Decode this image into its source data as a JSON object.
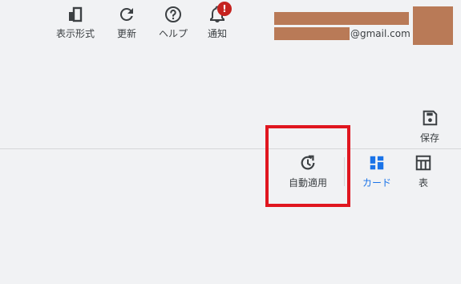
{
  "toolbar": {
    "display_format": "表示形式",
    "refresh": "更新",
    "help": "ヘルプ",
    "notifications": "通知",
    "notification_badge": "!"
  },
  "account": {
    "email_suffix": "@gmail.com"
  },
  "save": {
    "label": "保存"
  },
  "view": {
    "auto_apply": "自動適用",
    "card": "カード",
    "table": "表"
  },
  "colors": {
    "accent": "#1a73e8",
    "highlight": "#e0161f",
    "redacted": "#b97a57",
    "badge": "#c5221f"
  }
}
